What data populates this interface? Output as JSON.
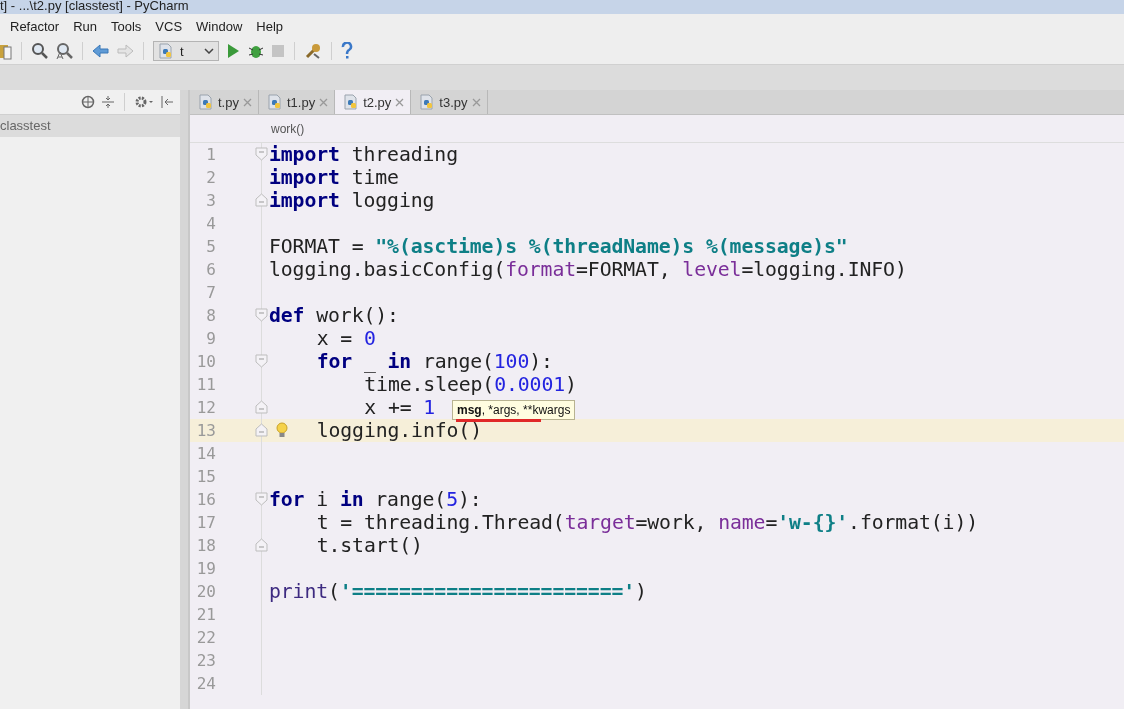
{
  "window": {
    "title": "t] - ...\\t2.py [classtest] - PyCharm"
  },
  "menu": [
    "Refactor",
    "Run",
    "Tools",
    "VCS",
    "Window",
    "Help"
  ],
  "toolbar": {
    "run_config": "t"
  },
  "project_panel": {
    "root": "classtest"
  },
  "tabs": [
    {
      "label": "t.py",
      "selected": false
    },
    {
      "label": "t1.py",
      "selected": false
    },
    {
      "label": "t2.py",
      "selected": true
    },
    {
      "label": "t3.py",
      "selected": false
    }
  ],
  "breadcrumb": "work()",
  "lines": [
    {
      "n": "1",
      "current": false,
      "fold_start": true,
      "tokens": [
        {
          "kind": "kw",
          "text": "import"
        },
        {
          "kind": "id",
          "text": " threading"
        }
      ]
    },
    {
      "n": "2",
      "current": false,
      "tokens": [
        {
          "kind": "kw",
          "text": "import"
        },
        {
          "kind": "id",
          "text": " time"
        }
      ]
    },
    {
      "n": "3",
      "current": false,
      "fold_end": true,
      "tokens": [
        {
          "kind": "kw",
          "text": "import"
        },
        {
          "kind": "id",
          "text": " logging"
        }
      ]
    },
    {
      "n": "4",
      "current": false
    },
    {
      "n": "5",
      "current": false,
      "tokens": [
        {
          "kind": "id",
          "text": "FORMAT = "
        },
        {
          "kind": "str",
          "text": "\"%(asctime)s %(threadName)s %(message)s\""
        }
      ]
    },
    {
      "n": "6",
      "current": false,
      "tokens": [
        {
          "kind": "id",
          "text": "logging.basicConfig("
        },
        {
          "kind": "param",
          "text": "format"
        },
        {
          "kind": "id",
          "text": "=FORMAT, "
        },
        {
          "kind": "param",
          "text": "level"
        },
        {
          "kind": "id",
          "text": "=logging.INFO)"
        }
      ]
    },
    {
      "n": "7",
      "current": false
    },
    {
      "n": "8",
      "current": false,
      "fold_start": true,
      "tokens": [
        {
          "kind": "kw",
          "text": "def"
        },
        {
          "kind": "id",
          "text": " work():"
        }
      ]
    },
    {
      "n": "9",
      "current": false,
      "tokens": [
        {
          "kind": "id",
          "text": "    x = "
        },
        {
          "kind": "num",
          "text": "0"
        }
      ]
    },
    {
      "n": "10",
      "current": false,
      "fold_start": true,
      "tokens": [
        {
          "kind": "kw",
          "text": "    for"
        },
        {
          "kind": "id",
          "text": " _ "
        },
        {
          "kind": "kw",
          "text": "in"
        },
        {
          "kind": "id",
          "text": " range("
        },
        {
          "kind": "num",
          "text": "100"
        },
        {
          "kind": "id",
          "text": "):"
        }
      ]
    },
    {
      "n": "11",
      "current": false,
      "tokens": [
        {
          "kind": "id",
          "text": "        time.sleep("
        },
        {
          "kind": "num",
          "text": "0.0001"
        },
        {
          "kind": "id",
          "text": ")"
        }
      ]
    },
    {
      "n": "12",
      "current": false,
      "fold_end": true,
      "tokens": [
        {
          "kind": "id",
          "text": "        x += "
        },
        {
          "kind": "num",
          "text": "1"
        }
      ]
    },
    {
      "n": "13",
      "current": true,
      "fold_end": true,
      "tokens": [
        {
          "kind": "id",
          "text": "    logging.info()"
        }
      ]
    },
    {
      "n": "14",
      "current": false
    },
    {
      "n": "15",
      "current": false
    },
    {
      "n": "16",
      "current": false,
      "fold_start": true,
      "tokens": [
        {
          "kind": "kw",
          "text": "for"
        },
        {
          "kind": "id",
          "text": " i "
        },
        {
          "kind": "kw",
          "text": "in"
        },
        {
          "kind": "id",
          "text": " range("
        },
        {
          "kind": "num",
          "text": "5"
        },
        {
          "kind": "id",
          "text": "):"
        }
      ]
    },
    {
      "n": "17",
      "current": false,
      "tokens": [
        {
          "kind": "id",
          "text": "    t = threading.Thread("
        },
        {
          "kind": "param",
          "text": "target"
        },
        {
          "kind": "id",
          "text": "=work, "
        },
        {
          "kind": "param",
          "text": "name"
        },
        {
          "kind": "id",
          "text": "="
        },
        {
          "kind": "str",
          "text": "'w-{}'"
        },
        {
          "kind": "id",
          "text": ".format(i))"
        }
      ]
    },
    {
      "n": "18",
      "current": false,
      "fold_end": true,
      "tokens": [
        {
          "kind": "id",
          "text": "    t.start()"
        }
      ]
    },
    {
      "n": "19",
      "current": false
    },
    {
      "n": "20",
      "current": false,
      "tokens": [
        {
          "kind": "builtin",
          "text": "print"
        },
        {
          "kind": "id",
          "text": "("
        },
        {
          "kind": "str",
          "text": "'======================='"
        },
        {
          "kind": "id",
          "text": ")"
        }
      ]
    },
    {
      "n": "21",
      "current": false
    },
    {
      "n": "22",
      "current": false
    },
    {
      "n": "23",
      "current": false
    },
    {
      "n": "24",
      "current": false
    }
  ],
  "param_hint": {
    "parts": [
      {
        "text": "msg",
        "bold": true
      },
      {
        "text": ", *args, **kwargs",
        "bold": false
      }
    ]
  }
}
